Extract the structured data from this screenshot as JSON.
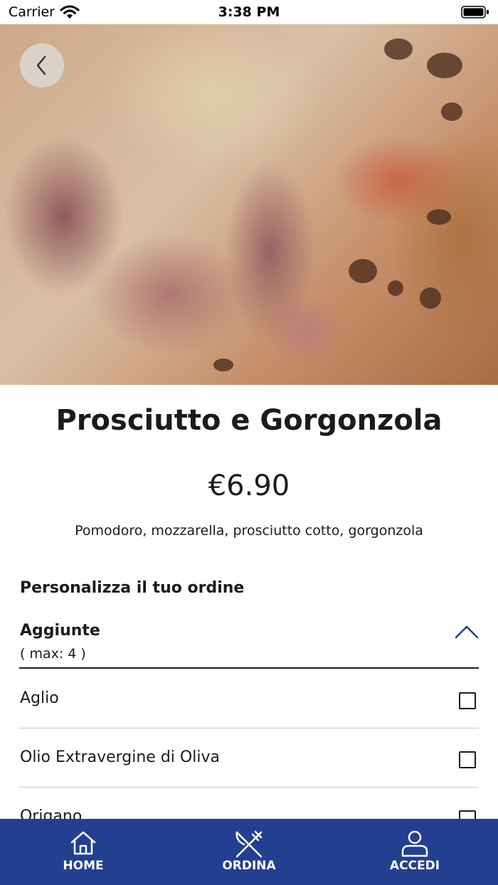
{
  "status_bar": {
    "carrier": "Carrier",
    "time": "3:38 PM"
  },
  "product": {
    "name": "Prosciutto e Gorgonzola",
    "price": "€6.90",
    "description": "Pomodoro, mozzarella, prosciutto cotto, gorgonzola"
  },
  "customize": {
    "heading": "Personalizza il tuo ordine",
    "group_title": "Aggiunte",
    "group_max": "(  max: 4 )",
    "options": [
      {
        "label": "Aglio",
        "checked": false
      },
      {
        "label": "Olio Extravergine di Oliva",
        "checked": false
      },
      {
        "label": "Origano",
        "checked": false
      }
    ]
  },
  "nav": {
    "home": "HOME",
    "order": "ORDINA",
    "login": "ACCEDI"
  },
  "icons": {
    "back": "chevron-left-icon",
    "collapse": "chevron-up-icon",
    "home": "house-icon",
    "order": "fork-knife-icon",
    "login": "user-icon"
  },
  "colors": {
    "nav_background": "#233f8f",
    "accent": "#233f8f",
    "text": "#1b1b1b"
  }
}
